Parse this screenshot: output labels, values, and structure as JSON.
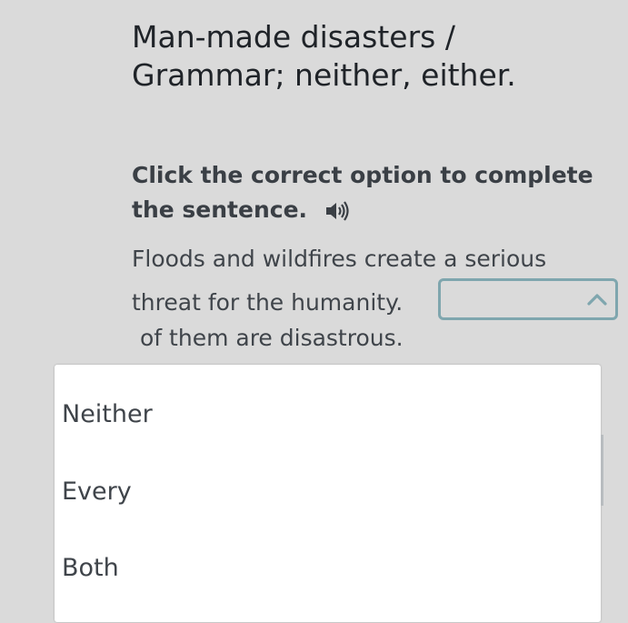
{
  "title": {
    "line1": "Man-made disasters /",
    "line2": "Grammar; neither, either."
  },
  "instruction": {
    "line1": "Click the correct option to complete",
    "line2": "the sentence.",
    "audio_icon": "speaker-icon"
  },
  "sentence": {
    "line1": "Floods and wildfires create a serious",
    "line2": "threat for the humanity.",
    "line3": "of them are disastrous."
  },
  "select": {
    "value": "",
    "icon": "chevron-up-icon",
    "border_color": "#7fa6ae"
  },
  "dropdown": {
    "options": [
      "Neither",
      "Every",
      "Both"
    ]
  },
  "colors": {
    "background": "#dadada",
    "text": "#3f444a",
    "accent": "#7fa6ae"
  }
}
